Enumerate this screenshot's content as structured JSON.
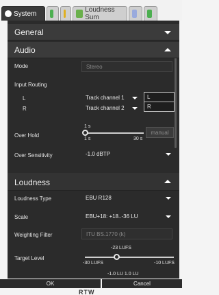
{
  "tabs": [
    {
      "label": "System"
    },
    {
      "label": "Loudness Sum"
    }
  ],
  "sections": {
    "general": {
      "title": "General"
    },
    "audio": {
      "title": "Audio"
    },
    "loudness": {
      "title": "Loudness"
    }
  },
  "audio": {
    "mode": {
      "label": "Mode",
      "value": "Stereo"
    },
    "input_routing": {
      "label": "Input Routing",
      "left": {
        "label": "L",
        "channel": "Track channel 1",
        "name": "L"
      },
      "right": {
        "label": "R",
        "channel": "Track channel 2",
        "name": "R"
      }
    },
    "over_hold": {
      "label": "Over Hold",
      "value": "1 s",
      "min": "1 s",
      "max": "30 s",
      "manual_label": "manual",
      "level": 0.0
    },
    "over_sensitivity": {
      "label": "Over Sensitivity",
      "value": "-1.0 dBTP"
    }
  },
  "loudness": {
    "type": {
      "label": "Loudness Type",
      "value": "EBU R128"
    },
    "scale": {
      "label": "Scale",
      "value": "EBU+18: +18..-36 LU"
    },
    "weighting_filter": {
      "label": "Weighting Filter",
      "value": "ITU BS.1770 (k)"
    },
    "target_level": {
      "label": "Target Level",
      "value": "-23 LUFS",
      "min": "-30 LUFS",
      "max": "-10 LUFS",
      "level": 0.35
    },
    "extra_values": "-1.0 LU  1.0 LU"
  },
  "buttons": {
    "ok": "OK",
    "cancel": "Cancel"
  },
  "logo": "RTW"
}
